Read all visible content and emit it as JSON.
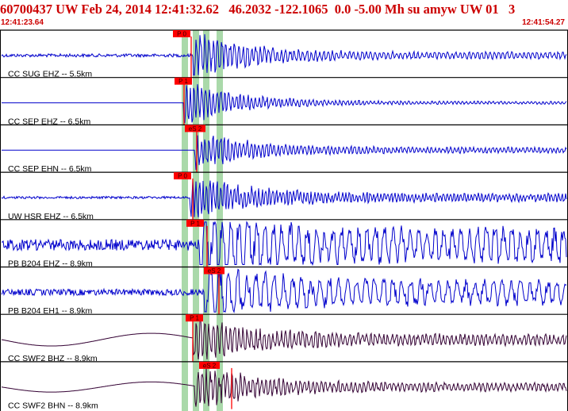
{
  "header": {
    "title": "60700437 UW Feb 24, 2014 12:41:32.62   46.2032 -122.1065  0.0 -5.00 Mh su amyw UW 01   3",
    "time_start": "12:41:23.64",
    "time_end": "12:41:54.27"
  },
  "colors": {
    "trace_blue": "#0000cc",
    "trace_purple": "#330033",
    "pick_red": "#ff0000",
    "window_green": "#aad9aa",
    "title_red": "#cc0000",
    "border_black": "#000000"
  },
  "chart_data": {
    "type": "line",
    "title": "60700437 UW Feb 24, 2014 12:41:32.62   46.2032 -122.1065  0.0 -5.00 Mh su amyw UW 01   3",
    "x_range": [
      "12:41:23.64",
      "12:41:54.27"
    ],
    "traces": [
      {
        "name": "CC SUG EHZ -- 5.5km",
        "pick": "P 0",
        "color": "trace_blue"
      },
      {
        "name": "CC SEP EHZ -- 6.5km",
        "pick": "P 1",
        "color": "trace_blue"
      },
      {
        "name": "CC SEP EHN -- 6.5km",
        "pick": "eS 2",
        "color": "trace_blue"
      },
      {
        "name": "UW HSR EHZ -- 6.5km",
        "pick": "P 0",
        "color": "trace_blue"
      },
      {
        "name": "PB B204 EHZ -- 8.9km",
        "pick": "P 1",
        "color": "trace_blue"
      },
      {
        "name": "PB B204 EH1 -- 8.9km",
        "pick": "eS 2",
        "color": "trace_blue"
      },
      {
        "name": "CC SWF2 BHZ -- 8.9km",
        "pick": "P 1",
        "color": "trace_purple"
      },
      {
        "name": "CC SWF2 BHN -- 8.9km",
        "pick": "eS 2",
        "color": "trace_purple"
      }
    ]
  }
}
